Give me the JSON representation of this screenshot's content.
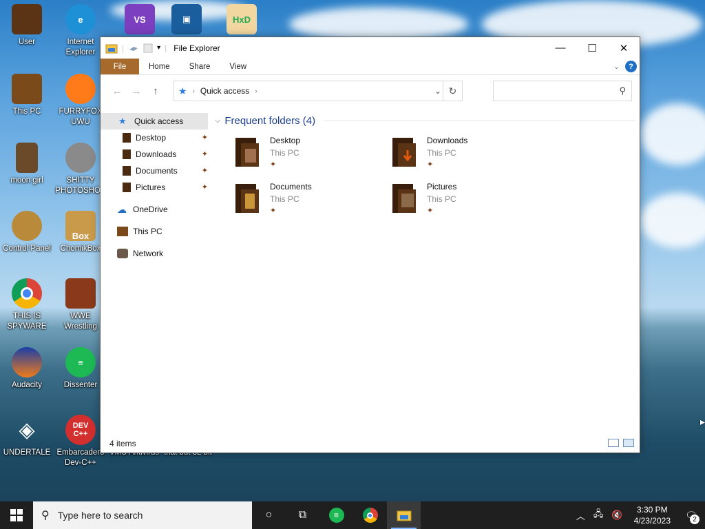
{
  "desktop": {
    "icons": [
      {
        "label": "User",
        "icon": "user-folder-icon",
        "color": "#5a3415"
      },
      {
        "label": "Internet Explorer",
        "icon": "edge-icon",
        "color": "#1e90d6"
      },
      {
        "label": "This PC",
        "icon": "computer-icon",
        "color": "#7a4a1a"
      },
      {
        "label": "FURRYFOX UWU",
        "icon": "firefox-icon",
        "color": "#ff7a18"
      },
      {
        "label": "moon girl",
        "icon": "book-icon",
        "color": "#6b4a2a"
      },
      {
        "label": "SHITTY PHOTOSHOP",
        "icon": "gimp-icon",
        "color": "#8a8a8a"
      },
      {
        "label": "Control Panel",
        "icon": "control-panel-icon",
        "color": "#b88a3a"
      },
      {
        "label": "ChomikBox",
        "icon": "hamster-icon",
        "color": "#c99a4a"
      },
      {
        "label": "THIS IS SPYWARE",
        "icon": "chrome-icon",
        "color": "#4285f4"
      },
      {
        "label": "WWE Wrestling",
        "icon": "wrestling-icon",
        "color": "#8a3a1a"
      },
      {
        "label": "Audacity",
        "icon": "audacity-icon",
        "color": "#f07a1a"
      },
      {
        "label": "Dissenter",
        "icon": "dissenter-icon",
        "color": "#1db954"
      },
      {
        "label": "UNDERTALE",
        "icon": "unity-icon",
        "color": "#222222"
      },
      {
        "label": "Embarcadero Dev-C++",
        "icon": "devcpp-icon",
        "color": "#d32f2f"
      },
      {
        "label": "VMU Antivirus",
        "icon": "antivirus-icon",
        "color": "#666666"
      },
      {
        "label": "that but 32 bit",
        "icon": "app-icon",
        "color": "#666666"
      }
    ],
    "top_icons": [
      {
        "icon": "visual-studio-icon",
        "color": "#7b3fbf"
      },
      {
        "icon": "virtualbox-icon",
        "color": "#1b5e9e"
      },
      {
        "icon": "hxd-icon",
        "color": "#e89a2a"
      }
    ]
  },
  "window": {
    "title": "File Explorer",
    "ribbon_tabs": [
      "File",
      "Home",
      "Share",
      "View"
    ],
    "address": {
      "location": "Quick access"
    },
    "search": {
      "placeholder": ""
    },
    "nav": {
      "quick_access": "Quick access",
      "pinned": [
        "Desktop",
        "Downloads",
        "Documents",
        "Pictures"
      ],
      "onedrive": "OneDrive",
      "this_pc": "This PC",
      "network": "Network"
    },
    "content": {
      "group_title": "Frequent folders (4)",
      "folders": [
        {
          "name": "Desktop",
          "location": "This PC"
        },
        {
          "name": "Downloads",
          "location": "This PC"
        },
        {
          "name": "Documents",
          "location": "This PC"
        },
        {
          "name": "Pictures",
          "location": "This PC"
        }
      ]
    },
    "status": {
      "item_count": "4 items"
    }
  },
  "taskbar": {
    "search_placeholder": "Type here to search",
    "time": "3:30 PM",
    "date": "4/23/2023",
    "notification_count": "2"
  },
  "colors": {
    "accent_file_tab": "#a56a2c",
    "link_blue": "#1e3f8f",
    "taskbar_bg": "#1f1f1f"
  }
}
